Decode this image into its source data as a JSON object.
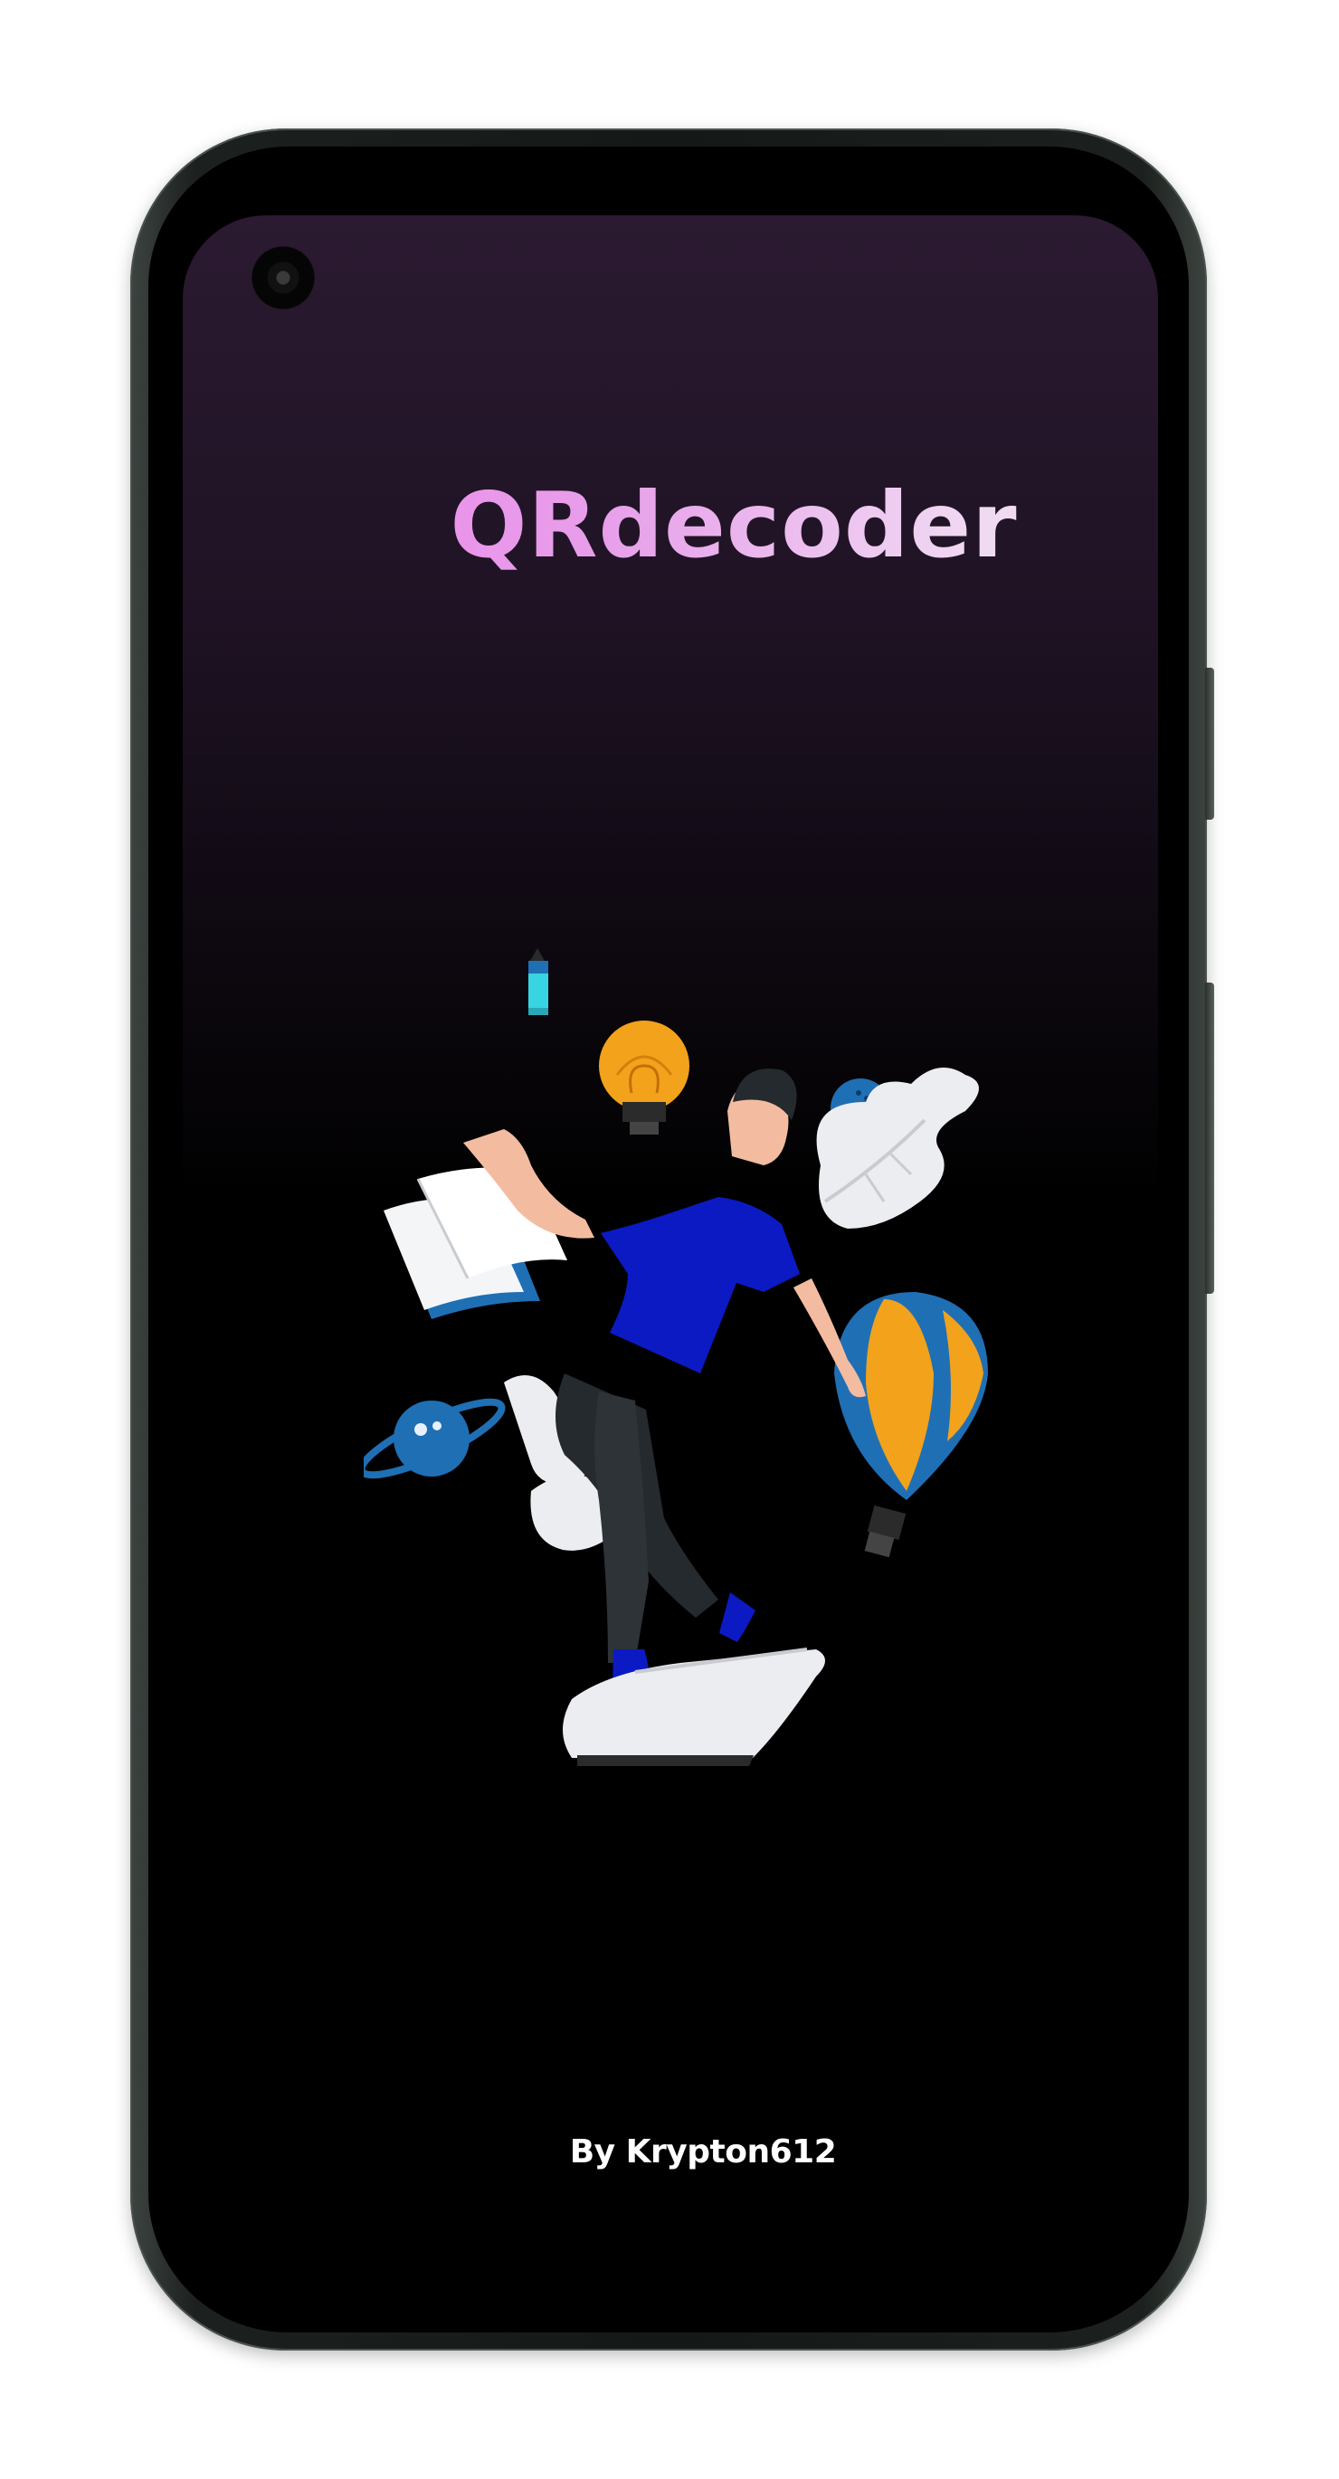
{
  "app": {
    "title": "QRdecoder",
    "author_credit": "By Krypton612"
  },
  "illustration": {
    "subject": "person-juggling-ideas",
    "icons": [
      "pencil-icon",
      "lightbulb-icon",
      "ball-icon",
      "book-icon",
      "leaf-icon",
      "planet-icon",
      "hot-air-balloon-icon",
      "cloud-icon",
      "shoe-book-icon"
    ]
  },
  "colors": {
    "title_gradient_start": "#ee85ec",
    "title_gradient_end": "#f2eef2",
    "screen_top": "#2b1a31",
    "screen_bottom": "#000000",
    "shirt_blue": "#0c1ac4",
    "accent_orange": "#f3a21b",
    "accent_blue": "#1f6fb5"
  }
}
